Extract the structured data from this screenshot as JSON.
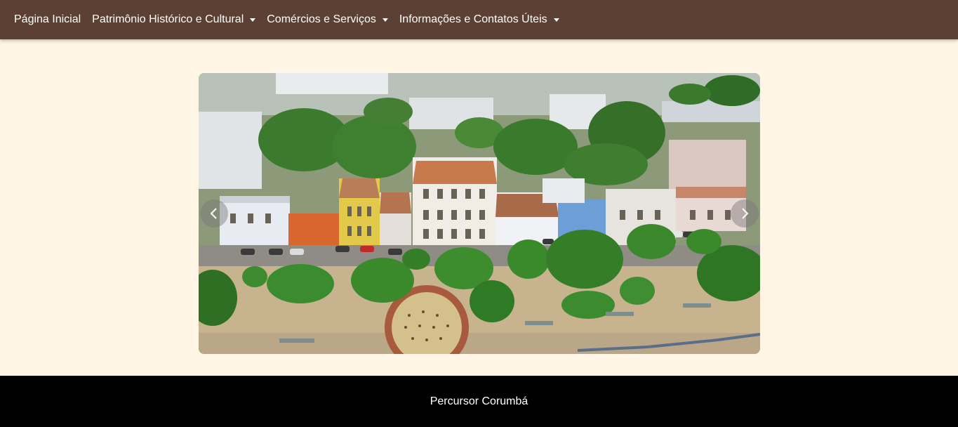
{
  "navbar": {
    "items": [
      {
        "label": "Página Inicial",
        "dropdown": false
      },
      {
        "label": "Patrimônio Histórico e Cultural",
        "dropdown": true
      },
      {
        "label": "Comércios e Serviços",
        "dropdown": true
      },
      {
        "label": "Informações e Contatos Úteis",
        "dropdown": true
      }
    ],
    "background": "#5c4033"
  },
  "carousel": {
    "image": "aerial-photo-historic-waterfront",
    "prev_icon": "chevron-left-icon",
    "next_icon": "chevron-right-icon"
  },
  "footer": {
    "text": "Percursor Corumbá"
  },
  "colors": {
    "page_background": "#fff5e5",
    "footer_background": "#000000"
  }
}
